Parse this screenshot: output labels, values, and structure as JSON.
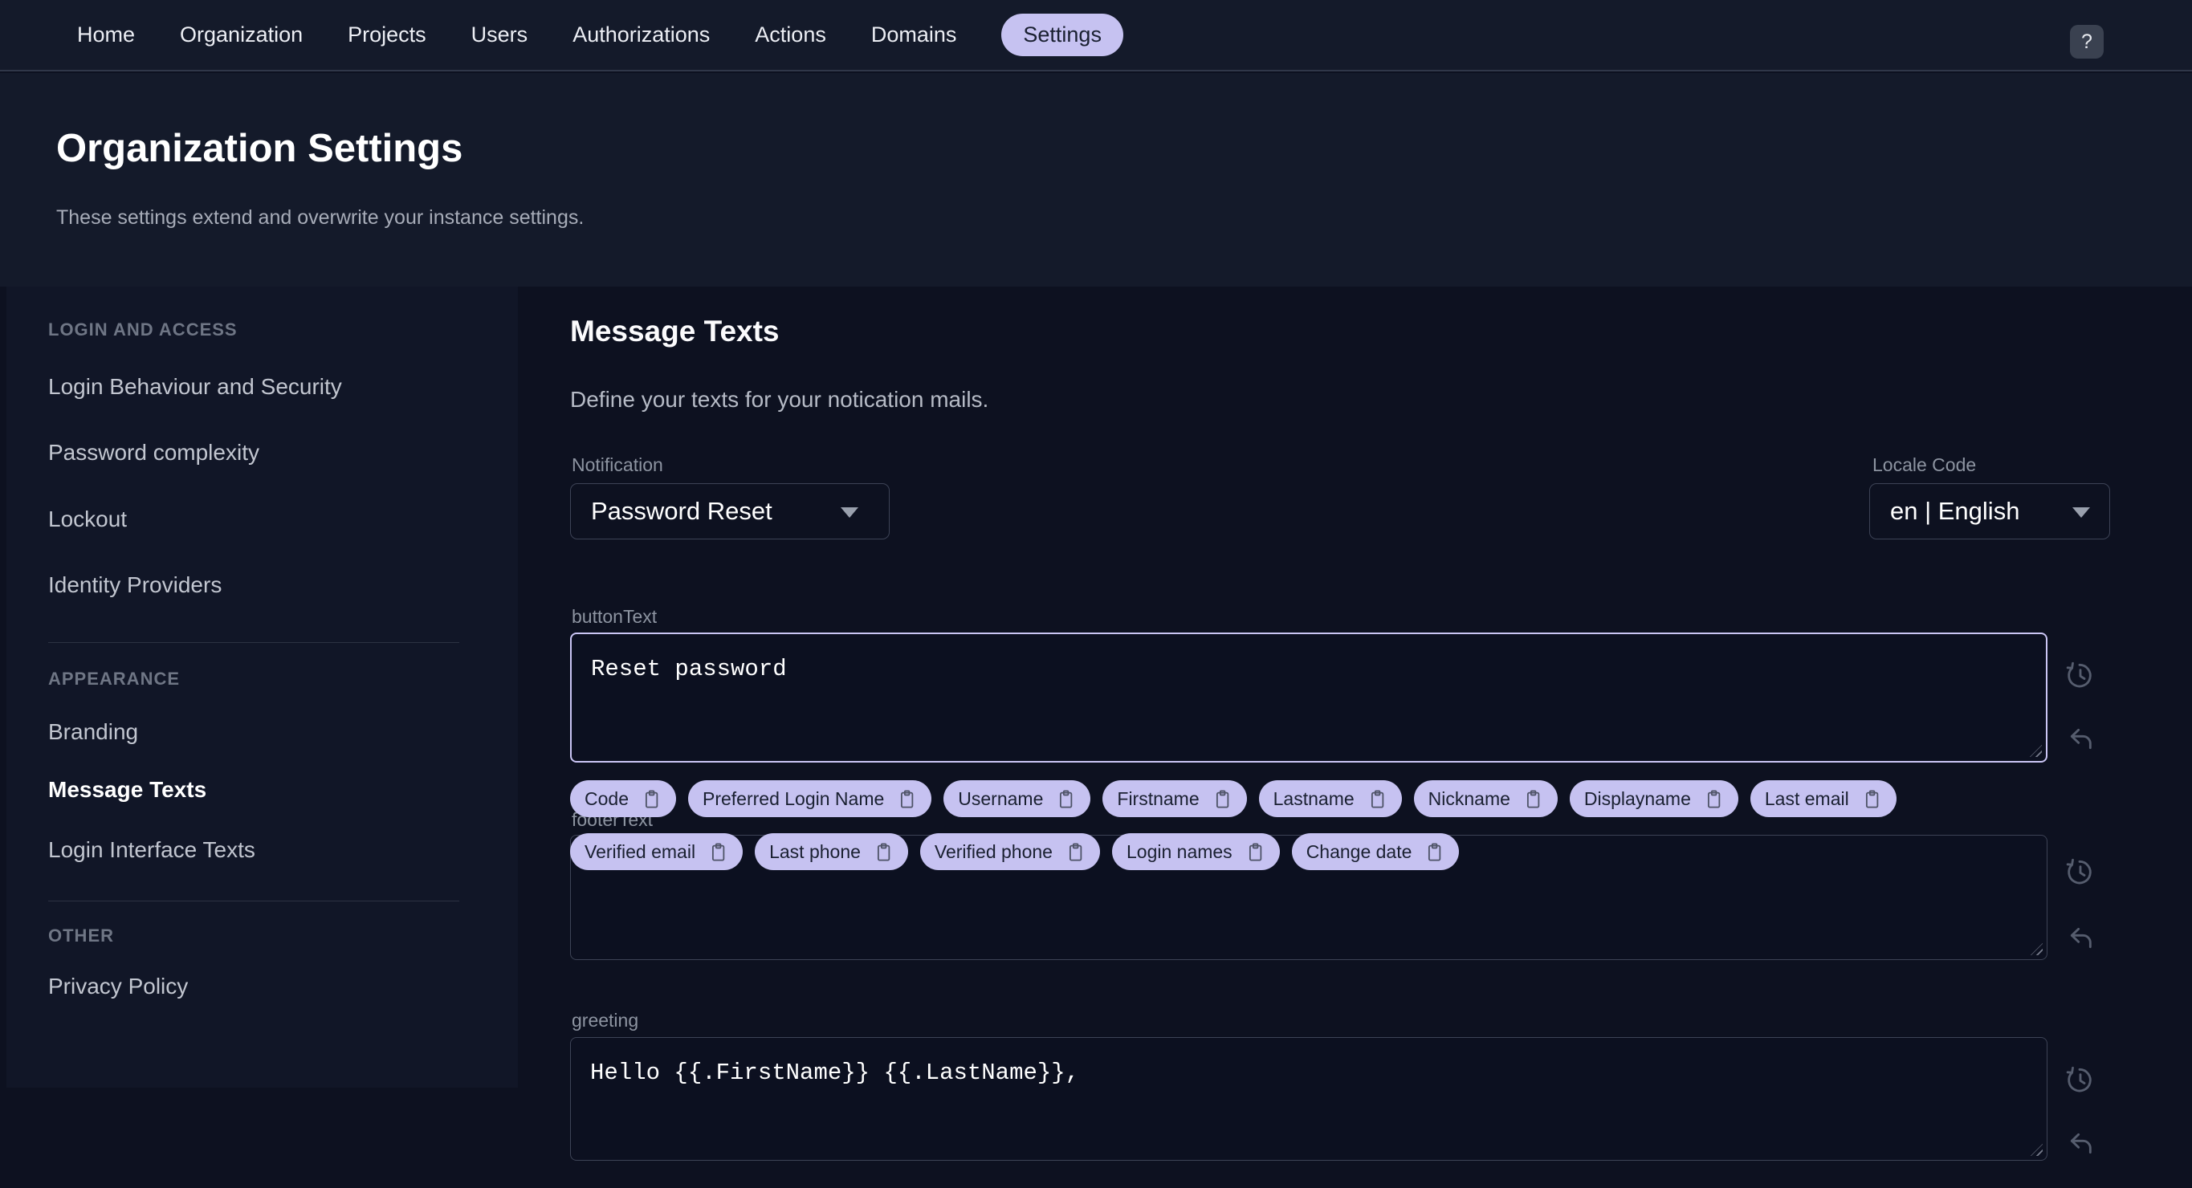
{
  "nav": {
    "items": [
      "Home",
      "Organization",
      "Projects",
      "Users",
      "Authorizations",
      "Actions",
      "Domains",
      "Settings"
    ],
    "active": "Settings",
    "help_label": "?"
  },
  "header": {
    "title": "Organization Settings",
    "subtitle": "These settings extend and overwrite your instance settings."
  },
  "sidebar": {
    "sections": [
      {
        "heading": "LOGIN AND ACCESS",
        "items": [
          "Login Behaviour and Security",
          "Password complexity",
          "Lockout",
          "Identity Providers"
        ]
      },
      {
        "heading": "APPEARANCE",
        "items": [
          "Branding",
          "Message Texts",
          "Login Interface Texts"
        ]
      },
      {
        "heading": "OTHER",
        "items": [
          "Privacy Policy"
        ]
      }
    ],
    "active_item": "Message Texts"
  },
  "main": {
    "title": "Message Texts",
    "subtitle": "Define your texts for your notication mails.",
    "notification": {
      "label": "Notification",
      "value": "Password Reset"
    },
    "locale": {
      "label": "Locale Code",
      "value": "en | English"
    },
    "fields": {
      "buttonText": {
        "label": "buttonText",
        "value": "Reset password",
        "focused": true
      },
      "footerText": {
        "label": "footerText",
        "value": ""
      },
      "greeting": {
        "label": "greeting",
        "value": "Hello {{.FirstName}} {{.LastName}},"
      }
    },
    "chips": {
      "row1": [
        "Code",
        "Preferred Login Name",
        "Username",
        "Firstname",
        "Lastname",
        "Nickname",
        "Displayname",
        "Last email"
      ],
      "row2": [
        "Verified email",
        "Last phone",
        "Verified phone",
        "Login names",
        "Change date"
      ]
    }
  },
  "icons": {
    "chip_icon": "clipboard-icon",
    "field_actions": [
      "history-icon",
      "undo-icon"
    ],
    "select_caret": "caret-down-icon",
    "help": "question-mark-icon"
  },
  "colors": {
    "accent": "#c6c2f1",
    "focus_border": "#cbc6f5",
    "background": "#0d1120",
    "header_background": "#141a2a",
    "sidebar_background": "#111627",
    "chip_text": "#1a2031"
  }
}
